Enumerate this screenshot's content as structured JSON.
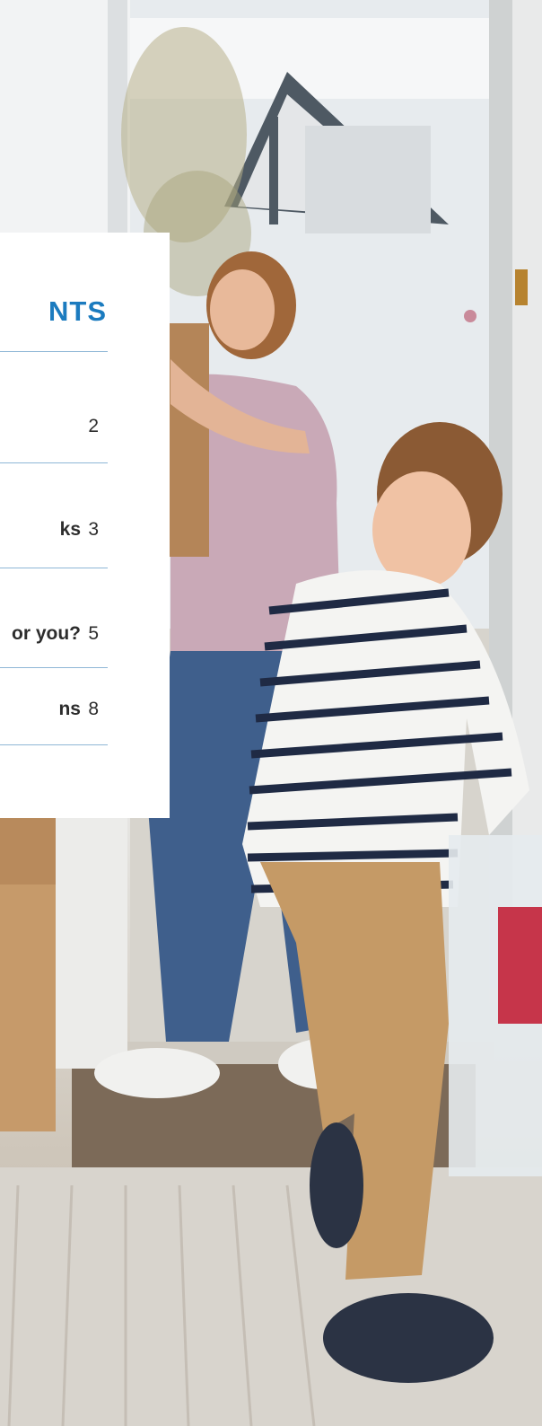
{
  "toc": {
    "title": "NTS",
    "entries": [
      {
        "label": "",
        "page": "2"
      },
      {
        "label": "ks",
        "page": "3"
      },
      {
        "label": "or you?",
        "page": "5"
      },
      {
        "label": "ns",
        "page": "8"
      }
    ]
  },
  "colors": {
    "accent": "#1b7bbf",
    "rule": "#8fb7d6",
    "text": "#2d2d2d"
  }
}
